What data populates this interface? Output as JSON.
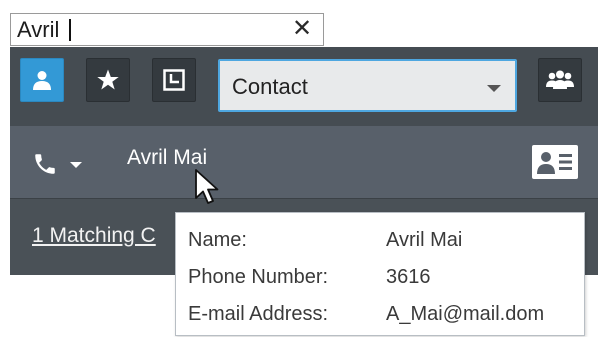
{
  "search": {
    "value": "Avril",
    "clear_icon": "x-icon",
    "clear_glyph": "✕"
  },
  "toolbar": {
    "buttons": [
      {
        "icon": "person-icon",
        "active": true
      },
      {
        "icon": "star-icon",
        "active": false
      },
      {
        "icon": "recent-history-icon",
        "active": false
      }
    ],
    "filter_select": {
      "value": "Contact"
    },
    "right_button": {
      "icon": "group-icon"
    }
  },
  "result": {
    "contact_name": "Avril Mai",
    "phone_icon": "phone-icon",
    "card_icon": "contact-card-icon"
  },
  "matching_text": "1 Matching C",
  "tooltip": {
    "rows": [
      {
        "label": "Name:",
        "value": "Avril  Mai"
      },
      {
        "label": "Phone Number:",
        "value": "3616"
      },
      {
        "label": "E-mail Address:",
        "value": "A_Mai@mail.dom"
      }
    ]
  },
  "colors": {
    "panel": "#4a5157",
    "toolbar": "#454c52",
    "active_button": "#3399d6",
    "select_border": "#4ea7e0",
    "contact_row": "#58606a"
  }
}
